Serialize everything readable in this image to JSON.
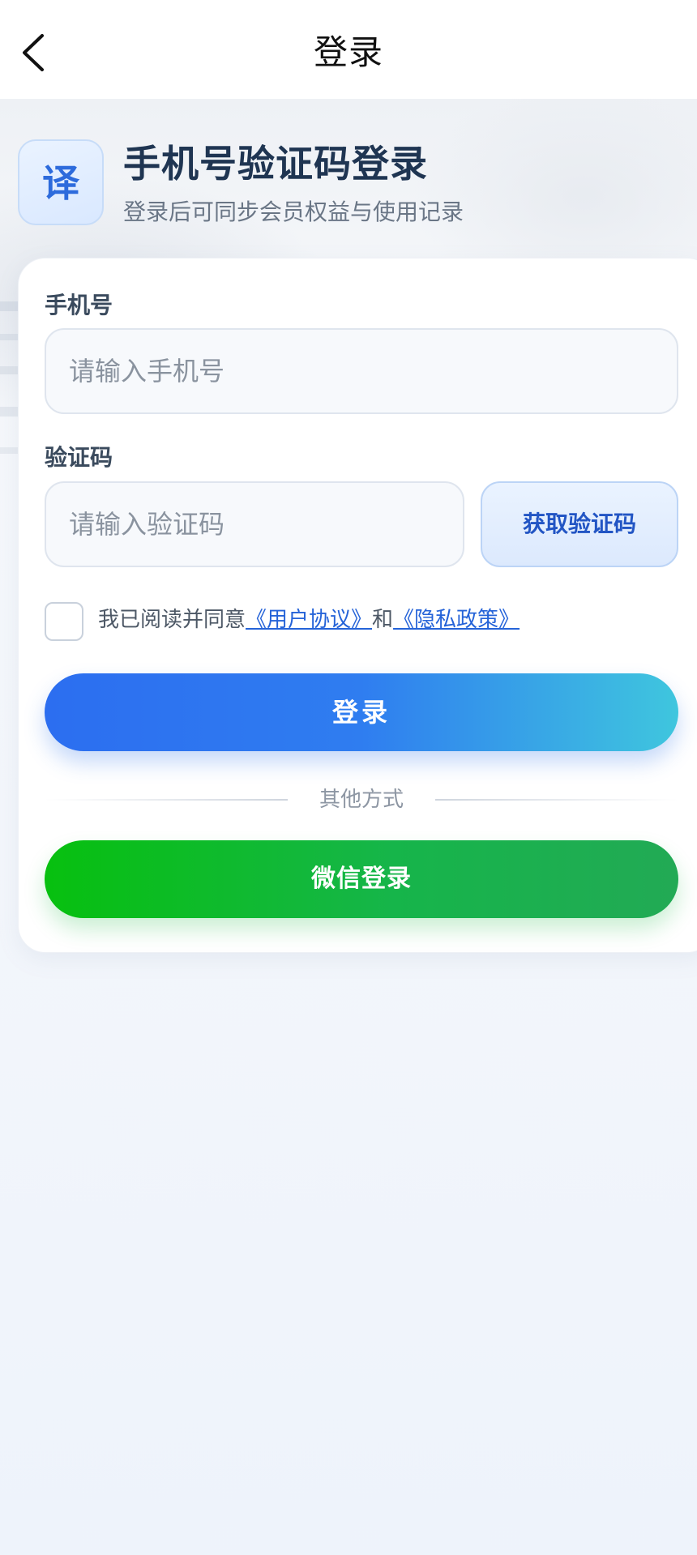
{
  "navbar": {
    "title": "登录",
    "back_icon": "chevron-left-icon"
  },
  "header": {
    "badge_text": "译",
    "title": "手机号验证码登录",
    "subtitle": "登录后可同步会员权益与使用记录"
  },
  "form": {
    "phone_label": "手机号",
    "phone_placeholder": "请输入手机号",
    "phone_value": "",
    "code_label": "验证码",
    "code_placeholder": "请输入验证码",
    "code_value": "",
    "get_code_label": "获取验证码"
  },
  "agreement": {
    "checked": false,
    "prefix": "我已阅读并同意",
    "user_agreement": "《用户协议》",
    "conjunction": "和",
    "privacy_policy": "《隐私政策》"
  },
  "actions": {
    "login_label": "登录",
    "divider_text": "其他方式",
    "wechat_label": "微信登录"
  },
  "colors": {
    "primary_blue": "#2c6ef0",
    "gradient_cyan": "#3fc6de",
    "wechat_green": "#07c00f",
    "link_blue": "#2563d8"
  }
}
